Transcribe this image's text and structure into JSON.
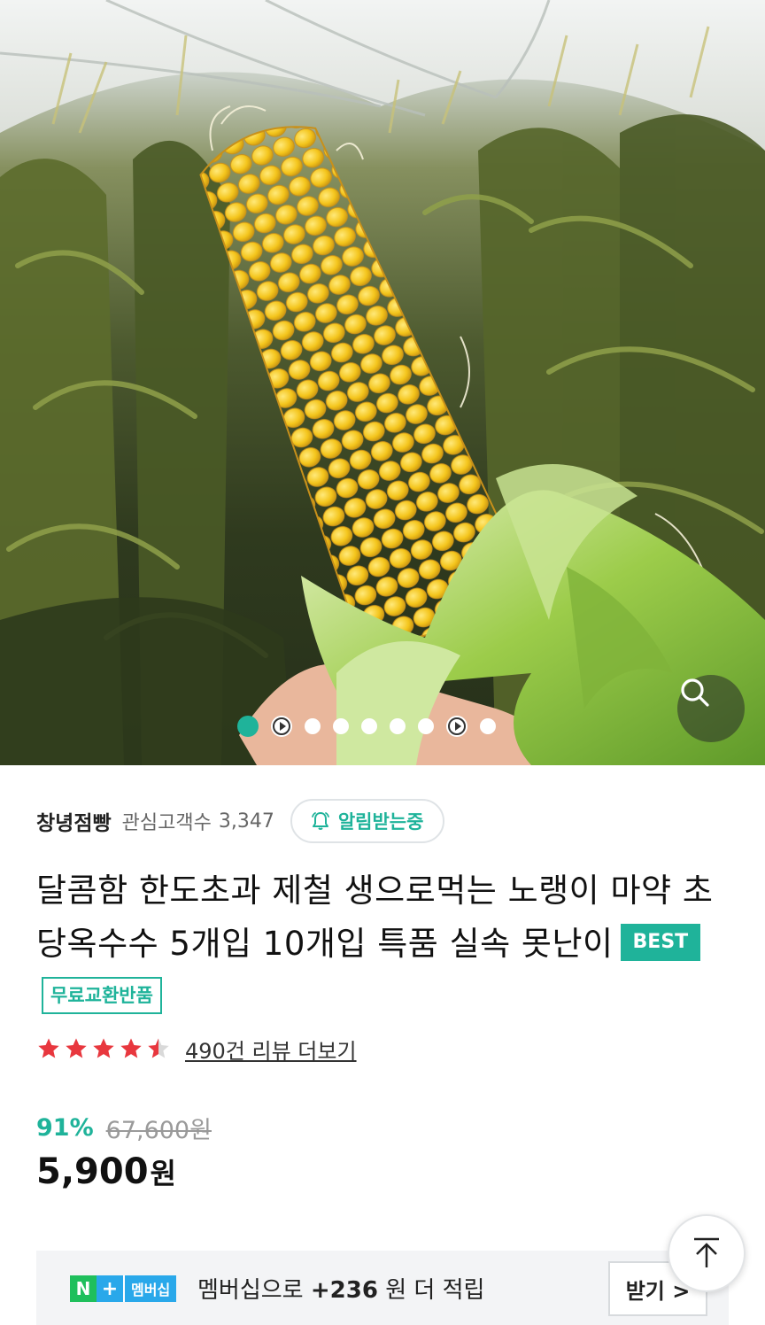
{
  "hero": {
    "image_alt_icon": "corn-photo",
    "slide_count": 9,
    "active_slide": 1,
    "video_slides": [
      2,
      8
    ],
    "zoom_icon": "search-icon"
  },
  "seller": {
    "name": "창녕점빵",
    "follower_label": "관심고객수",
    "follower_count": "3,347",
    "notify_label": "알림받는중",
    "notify_icon": "bell-icon"
  },
  "product": {
    "title": "달콤함 한도초과 제철 생으로먹는 노랭이 마약 초당옥수수 5개입 10개입 특품 실속 못난이",
    "badge_best": "BEST",
    "badge_free": "무료교환반품"
  },
  "rating": {
    "score": 4.5,
    "max": 5,
    "review_link": "490건 리뷰 더보기"
  },
  "price": {
    "discount": "91%",
    "original": "67,600원",
    "sale_number": "5,900",
    "sale_unit": "원"
  },
  "membership": {
    "logo_n": "N",
    "logo_plus": "+",
    "logo_label": "멤버십",
    "text_prefix": "멤버십으로",
    "points": "+236",
    "text_suffix": "원 더 적립",
    "button_label": "받기 >"
  },
  "colors": {
    "accent": "#1fb39a",
    "star": "#e8373e",
    "naver_green": "#1fbf5c",
    "naver_blue": "#29a8ea"
  }
}
